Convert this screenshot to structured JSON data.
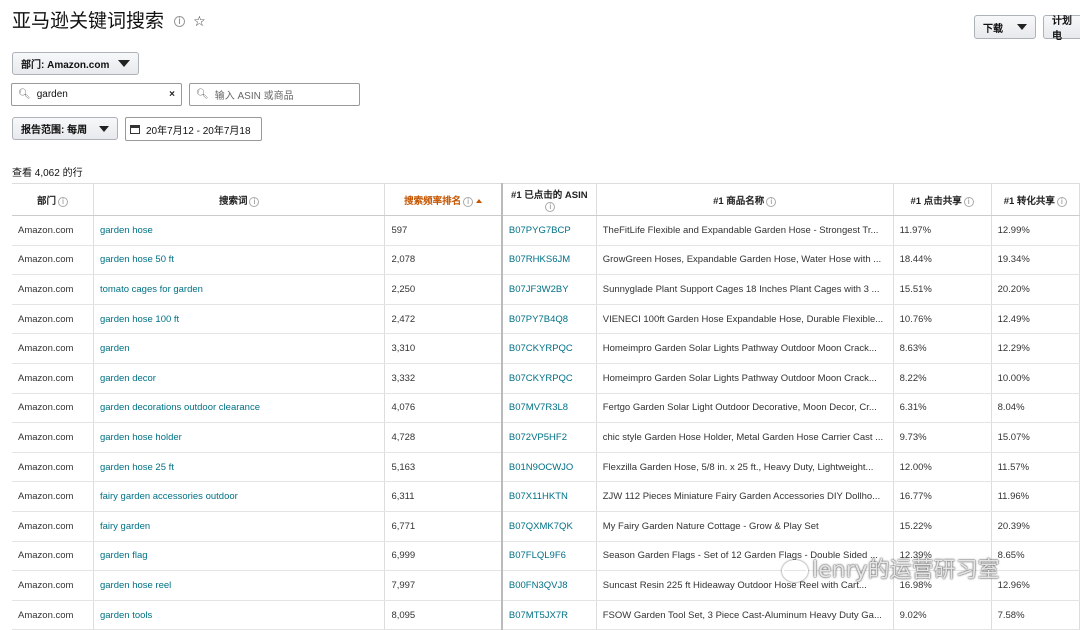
{
  "header": {
    "title": "亚马逊关键词搜索",
    "info_icon": "info-icon",
    "star_icon": "star-icon",
    "download_label": "下载",
    "plan_label": "计划电"
  },
  "filters": {
    "department_label": "部门: Amazon.com",
    "search_value": "garden",
    "asin_placeholder": "输入 ASIN 或商品",
    "report_range_label": "报告范围: 每周",
    "date_range_value": "20年7月12 - 20年7月18"
  },
  "summary": {
    "count_text": "查看 4,062 的行"
  },
  "table": {
    "columns": [
      "部门",
      "搜索词",
      "搜索频率排名",
      "#1 已点击的 ASIN",
      "#1 商品名称",
      "#1 点击共享",
      "#1 转化共享"
    ],
    "rows": [
      [
        "Amazon.com",
        "garden hose",
        "597",
        "B07PYG7BCP",
        "TheFitLife Flexible and Expandable Garden Hose - Strongest Tr...",
        "11.97%",
        "12.99%"
      ],
      [
        "Amazon.com",
        "garden hose 50 ft",
        "2,078",
        "B07RHKS6JM",
        "GrowGreen Hoses, Expandable Garden Hose, Water Hose with ...",
        "18.44%",
        "19.34%"
      ],
      [
        "Amazon.com",
        "tomato cages for garden",
        "2,250",
        "B07JF3W2BY",
        "Sunnyglade Plant Support Cages 18 Inches Plant Cages with 3 ...",
        "15.51%",
        "20.20%"
      ],
      [
        "Amazon.com",
        "garden hose 100 ft",
        "2,472",
        "B07PY7B4Q8",
        "VIENECI 100ft Garden Hose Expandable Hose, Durable Flexible...",
        "10.76%",
        "12.49%"
      ],
      [
        "Amazon.com",
        "garden",
        "3,310",
        "B07CKYRPQC",
        "Homeimpro Garden Solar Lights Pathway Outdoor Moon Crack...",
        "8.63%",
        "12.29%"
      ],
      [
        "Amazon.com",
        "garden decor",
        "3,332",
        "B07CKYRPQC",
        "Homeimpro Garden Solar Lights Pathway Outdoor Moon Crack...",
        "8.22%",
        "10.00%"
      ],
      [
        "Amazon.com",
        "garden decorations outdoor clearance",
        "4,076",
        "B07MV7R3L8",
        "Fertgo Garden Solar Light Outdoor Decorative, Moon Decor, Cr...",
        "6.31%",
        "8.04%"
      ],
      [
        "Amazon.com",
        "garden hose holder",
        "4,728",
        "B072VP5HF2",
        "chic style Garden Hose Holder, Metal Garden Hose Carrier Cast ...",
        "9.73%",
        "15.07%"
      ],
      [
        "Amazon.com",
        "garden hose 25 ft",
        "5,163",
        "B01N9OCWJO",
        "Flexzilla Garden Hose, 5/8 in. x 25 ft., Heavy Duty, Lightweight...",
        "12.00%",
        "11.57%"
      ],
      [
        "Amazon.com",
        "fairy garden accessories outdoor",
        "6,311",
        "B07X11HKTN",
        "ZJW 112 Pieces Miniature Fairy Garden Accessories DIY Dollho...",
        "16.77%",
        "11.96%"
      ],
      [
        "Amazon.com",
        "fairy garden",
        "6,771",
        "B07QXMK7QK",
        "My Fairy Garden Nature Cottage - Grow & Play Set",
        "15.22%",
        "20.39%"
      ],
      [
        "Amazon.com",
        "garden flag",
        "6,999",
        "B07FLQL9F6",
        "Season Garden Flags - Set of 12 Garden Flags - Double Sided ...",
        "12.39%",
        "8.65%"
      ],
      [
        "Amazon.com",
        "garden hose reel",
        "7,997",
        "B00FN3QVJ8",
        "Suncast Resin 225 ft Hideaway Outdoor Hose Reel with Cart...",
        "16.98%",
        "12.96%"
      ],
      [
        "Amazon.com",
        "garden tools",
        "8,095",
        "B07MT5JX7R",
        "FSOW Garden Tool Set, 3 Piece Cast-Aluminum Heavy Duty Ga...",
        "9.02%",
        "7.58%"
      ]
    ]
  },
  "watermark": {
    "text": "lenry的运营研习室"
  }
}
